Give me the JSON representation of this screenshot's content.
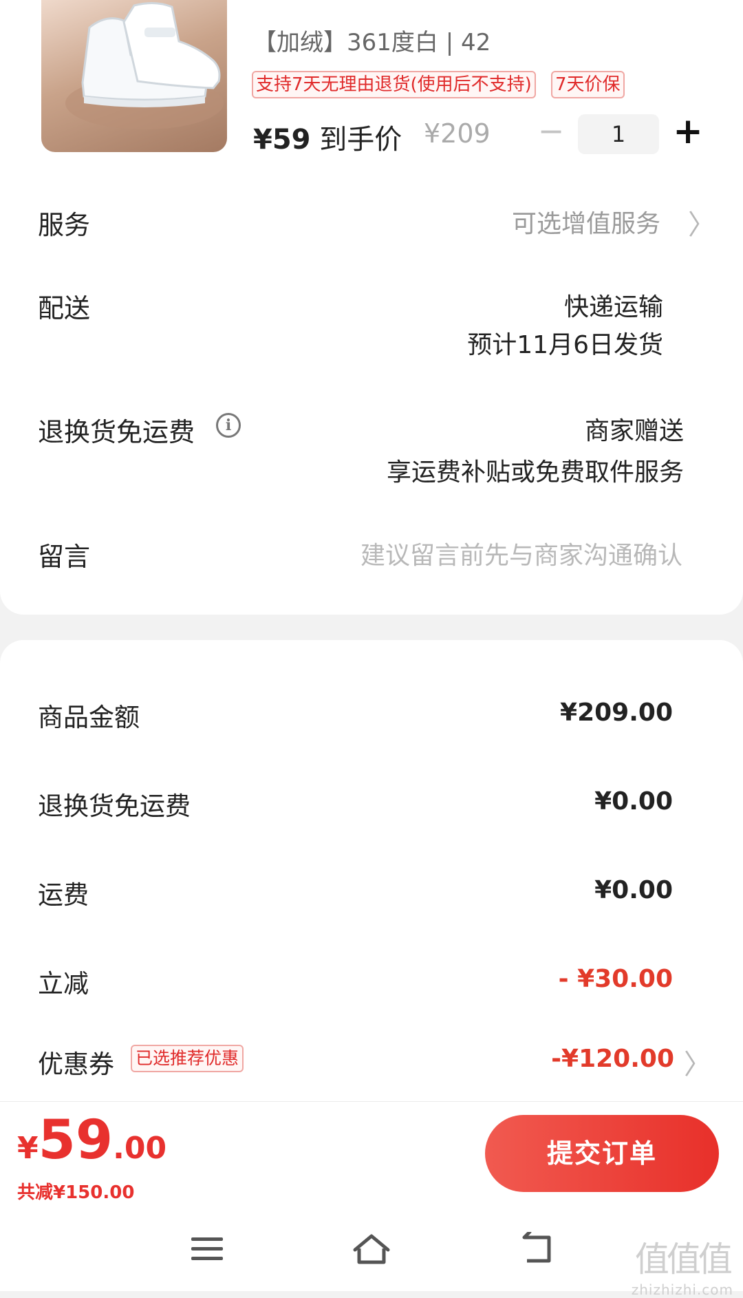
{
  "product": {
    "image_icon": "sneaker-photo",
    "spec": "【加绒】361度白 | 42",
    "tags": [
      "支持7天无理由退货(使用后不支持)",
      "7天价保"
    ],
    "final_price_currency": "¥",
    "final_price": "59",
    "final_price_label": "到手价",
    "original_price": "¥209",
    "quantity": "1",
    "minus_icon": "minus-icon",
    "plus_icon": "plus-icon"
  },
  "service": {
    "label": "服务",
    "value": "可选增值服务"
  },
  "delivery": {
    "label": "配送",
    "method": "快递运输",
    "estimate": "预计11月6日发货"
  },
  "return_shipping": {
    "label": "退换货免运费",
    "provider": "商家赠送",
    "desc": "享运费补贴或免费取件服务"
  },
  "note": {
    "label": "留言",
    "placeholder": "建议留言前先与商家沟通确认"
  },
  "summary": {
    "goods_amount": {
      "label": "商品金额",
      "value": "¥209.00"
    },
    "return_fee": {
      "label": "退换货免运费",
      "value": "¥0.00"
    },
    "shipping": {
      "label": "运费",
      "value": "¥0.00"
    },
    "instant_discount": {
      "label": "立减",
      "value": "- ¥30.00"
    },
    "coupon": {
      "label": "优惠券",
      "badge": "已选推荐优惠",
      "value": "-¥120.00"
    }
  },
  "footer": {
    "total_currency": "¥",
    "total_int": "59",
    "total_dec": ".00",
    "saved": "共减¥150.00",
    "submit": "提交订单"
  },
  "watermark": {
    "main": "值值值",
    "url": "zhizhizhi.com"
  },
  "colors": {
    "accent": "#e8312e",
    "tag_border": "#f0a7a3",
    "background": "#f2f2f2"
  }
}
